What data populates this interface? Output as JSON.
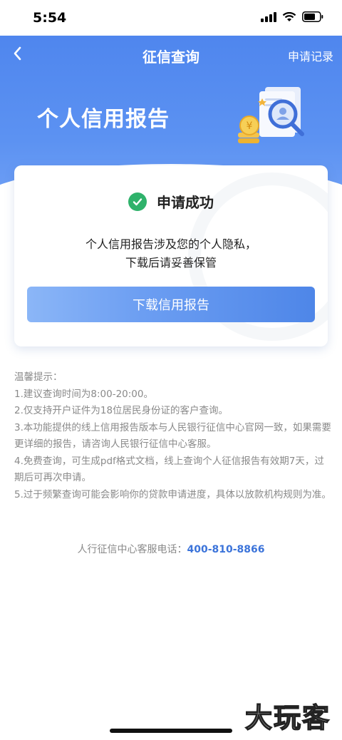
{
  "status": {
    "time": "5:54"
  },
  "nav": {
    "back_icon": "chevron-left-icon",
    "title": "征信查询",
    "right_label": "申请记录"
  },
  "hero": {
    "title": "个人信用报告"
  },
  "card": {
    "success_text": "申请成功",
    "notice_line1": "个人信用报告涉及您的个人隐私，",
    "notice_line2": "下载后请妥善保管",
    "download_button": "下载信用报告"
  },
  "tips": [
    "温馨提示：",
    "1.建议查询时间为8:00-20:00。",
    "2.仅支持开户证件为18位居民身份证的客户查询。",
    "3.本功能提供的线上信用报告版本与人民银行征信中心官网一致，如果需要更详细的报告，请咨询人民银行征信中心客服。",
    "4.免费查询，可生成pdf格式文档，线上查询个人征信报告有效期7天，过期后可再次申请。",
    "5.过于频繁查询可能会影响你的贷款申请进度，具体以放款机构规则为准。"
  ],
  "hotline": {
    "label": "人行征信中心客服电话：",
    "phone": "400-810-8866"
  },
  "watermark": "大玩客",
  "colors": {
    "primary": "#4F86EE",
    "success": "#2FB26B",
    "phone": "#3C74DA"
  }
}
